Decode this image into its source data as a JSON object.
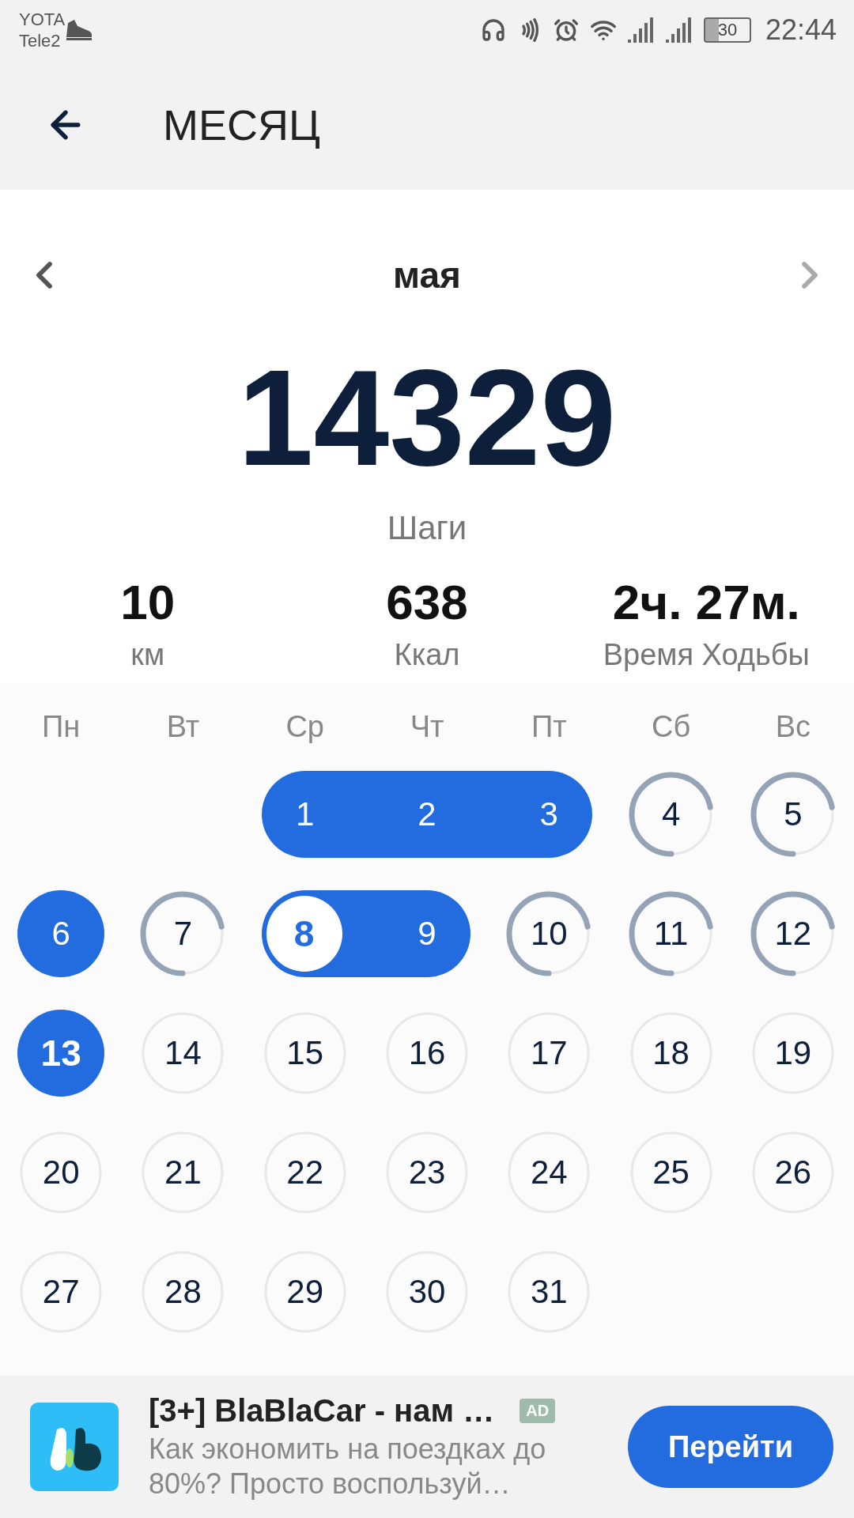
{
  "status_bar": {
    "carriers": [
      "YOTA",
      "Tele2"
    ],
    "battery": "30",
    "time": "22:44"
  },
  "app_bar": {
    "title": "МЕСЯЦ"
  },
  "period": {
    "month": "мая"
  },
  "summary": {
    "steps": "14329",
    "steps_label": "Шаги",
    "stats": [
      {
        "value": "10",
        "label": "км"
      },
      {
        "value": "638",
        "label": "Ккал"
      },
      {
        "value": "2ч. 27м.",
        "label": "Время Ходьбы"
      }
    ]
  },
  "weekdays": [
    "Пн",
    "Вт",
    "Ср",
    "Чт",
    "Пт",
    "Сб",
    "Вс"
  ],
  "weeks": [
    [
      {
        "kind": "empty"
      },
      {
        "kind": "empty"
      },
      {
        "day": "1",
        "kind": "goal",
        "selected": false,
        "today": false
      },
      {
        "day": "2",
        "kind": "goal",
        "selected": false,
        "today": false
      },
      {
        "day": "3",
        "kind": "goal",
        "selected": false,
        "today": false
      },
      {
        "day": "4",
        "kind": "progress",
        "selected": false,
        "today": false
      },
      {
        "day": "5",
        "kind": "progress",
        "selected": false,
        "today": false
      }
    ],
    [
      {
        "day": "6",
        "kind": "goal",
        "selected": false,
        "today": false
      },
      {
        "day": "7",
        "kind": "progress",
        "selected": false,
        "today": false
      },
      {
        "day": "8",
        "kind": "goal",
        "selected": true,
        "today": false
      },
      {
        "day": "9",
        "kind": "goal",
        "selected": false,
        "today": false
      },
      {
        "day": "10",
        "kind": "progress",
        "selected": false,
        "today": false
      },
      {
        "day": "11",
        "kind": "progress",
        "selected": false,
        "today": false
      },
      {
        "day": "12",
        "kind": "progress",
        "selected": false,
        "today": false
      }
    ],
    [
      {
        "day": "13",
        "kind": "goal",
        "selected": false,
        "today": true
      },
      {
        "day": "14",
        "kind": "future",
        "selected": false,
        "today": false
      },
      {
        "day": "15",
        "kind": "future",
        "selected": false,
        "today": false
      },
      {
        "day": "16",
        "kind": "future",
        "selected": false,
        "today": false
      },
      {
        "day": "17",
        "kind": "future",
        "selected": false,
        "today": false
      },
      {
        "day": "18",
        "kind": "future",
        "selected": false,
        "today": false
      },
      {
        "day": "19",
        "kind": "future",
        "selected": false,
        "today": false
      }
    ],
    [
      {
        "day": "20",
        "kind": "future",
        "selected": false,
        "today": false
      },
      {
        "day": "21",
        "kind": "future",
        "selected": false,
        "today": false
      },
      {
        "day": "22",
        "kind": "future",
        "selected": false,
        "today": false
      },
      {
        "day": "23",
        "kind": "future",
        "selected": false,
        "today": false
      },
      {
        "day": "24",
        "kind": "future",
        "selected": false,
        "today": false
      },
      {
        "day": "25",
        "kind": "future",
        "selected": false,
        "today": false
      },
      {
        "day": "26",
        "kind": "future",
        "selected": false,
        "today": false
      }
    ],
    [
      {
        "day": "27",
        "kind": "future",
        "selected": false,
        "today": false
      },
      {
        "day": "28",
        "kind": "future",
        "selected": false,
        "today": false
      },
      {
        "day": "29",
        "kind": "future",
        "selected": false,
        "today": false
      },
      {
        "day": "30",
        "kind": "future",
        "selected": false,
        "today": false
      },
      {
        "day": "31",
        "kind": "future",
        "selected": false,
        "today": false
      },
      {
        "kind": "empty"
      },
      {
        "kind": "empty"
      }
    ]
  ],
  "ad": {
    "title": "[3+] BlaBlaCar - нам …",
    "badge": "AD",
    "text": "Как экономить на поездках до 80%? Просто воспользуй…",
    "button": "Перейти"
  }
}
